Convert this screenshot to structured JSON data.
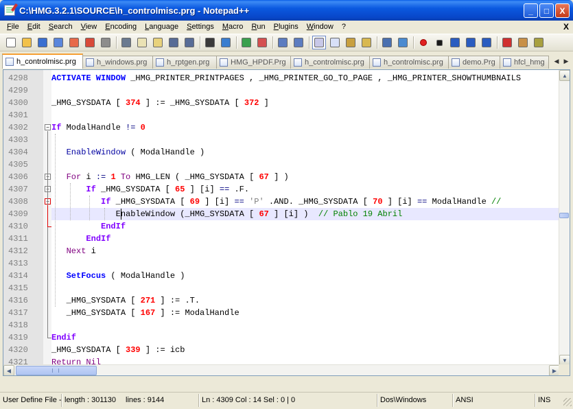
{
  "window": {
    "title": "C:\\HMG.3.2.1\\SOURCE\\h_controlmisc.prg - Notepad++",
    "minimize": "_",
    "maximize": "□",
    "close": "X"
  },
  "menu": {
    "items": [
      "File",
      "Edit",
      "Search",
      "View",
      "Encoding",
      "Language",
      "Settings",
      "Macro",
      "Run",
      "Plugins",
      "Window",
      "?"
    ],
    "close_doc": "X"
  },
  "toolbar": {
    "icons": [
      "new-file-icon",
      "open-file-icon",
      "save-icon",
      "save-all-icon",
      "close-icon",
      "close-all-icon",
      "print-icon",
      "cut-icon",
      "copy-icon",
      "paste-icon",
      "undo-icon",
      "redo-icon",
      "find-icon",
      "replace-icon",
      "zoom-in-icon",
      "zoom-out-icon",
      "sync-vertical-icon",
      "sync-horizontal-icon",
      "word-wrap-icon",
      "show-all-chars-icon",
      "indent-guide-icon",
      "user-define-lang-icon",
      "doc-map-icon",
      "function-list-icon",
      "record-macro-icon",
      "stop-macro-icon",
      "play-macro-icon",
      "run-macro-multiple-icon",
      "save-macro-icon",
      "spellcheck-icon",
      "clipboard-history-icon",
      "plugin-icon"
    ]
  },
  "tabs": [
    {
      "label": "h_controlmisc.prg",
      "active": true
    },
    {
      "label": "h_windows.prg",
      "active": false
    },
    {
      "label": "h_rptgen.prg",
      "active": false
    },
    {
      "label": "HMG_HPDF.Prg",
      "active": false
    },
    {
      "label": "h_controlmisc.prg",
      "active": false
    },
    {
      "label": "h_controlmisc.prg",
      "active": false
    },
    {
      "label": "demo.Prg",
      "active": false
    },
    {
      "label": "hfcl_hmg",
      "active": false
    }
  ],
  "editor": {
    "lines": [
      {
        "n": "4298",
        "segs": [
          [
            "kw",
            "ACTIVATE WINDOW"
          ],
          [
            "txt",
            " _HMG_PRINTER_PRINTPAGES , _HMG_PRINTER_GO_TO_PAGE , _HMG_PRINTER_SHOWTHUMBNAILS"
          ]
        ]
      },
      {
        "n": "4299",
        "segs": []
      },
      {
        "n": "4300",
        "segs": [
          [
            "txt",
            "_HMG_SYSDATA [ "
          ],
          [
            "num",
            "374"
          ],
          [
            "txt",
            " ] := _HMG_SYSDATA [ "
          ],
          [
            "num",
            "372"
          ],
          [
            "txt",
            " ]"
          ]
        ]
      },
      {
        "n": "4301",
        "segs": []
      },
      {
        "n": "4302",
        "segs": [
          [
            "kw2",
            "If"
          ],
          [
            "txt",
            " ModalHandle "
          ],
          [
            "op",
            "!="
          ],
          [
            "txt",
            " "
          ],
          [
            "num",
            "0"
          ]
        ]
      },
      {
        "n": "4303",
        "segs": []
      },
      {
        "n": "4304",
        "segs": [
          [
            "txt",
            "   "
          ],
          [
            "fn",
            "EnableWindow"
          ],
          [
            "txt",
            " ( ModalHandle )"
          ]
        ]
      },
      {
        "n": "4305",
        "segs": []
      },
      {
        "n": "4306",
        "segs": [
          [
            "txt",
            "   "
          ],
          [
            "kw3",
            "For"
          ],
          [
            "txt",
            " i "
          ],
          [
            "op",
            ":="
          ],
          [
            "txt",
            " "
          ],
          [
            "num",
            "1"
          ],
          [
            "txt",
            " "
          ],
          [
            "kw3",
            "To"
          ],
          [
            "txt",
            " HMG_LEN ( _HMG_SYSDATA [ "
          ],
          [
            "num",
            "67"
          ],
          [
            "txt",
            " ] )"
          ]
        ]
      },
      {
        "n": "4307",
        "segs": [
          [
            "txt",
            "       "
          ],
          [
            "kw2",
            "If"
          ],
          [
            "txt",
            " _HMG_SYSDATA [ "
          ],
          [
            "num",
            "65"
          ],
          [
            "txt",
            " ] [i] "
          ],
          [
            "op",
            "=="
          ],
          [
            "txt",
            " .F."
          ]
        ]
      },
      {
        "n": "4308",
        "segs": [
          [
            "txt",
            "          "
          ],
          [
            "kw2",
            "If"
          ],
          [
            "txt",
            " _HMG_SYSDATA [ "
          ],
          [
            "num",
            "69"
          ],
          [
            "txt",
            " ] [i] "
          ],
          [
            "op",
            "=="
          ],
          [
            "txt",
            " "
          ],
          [
            "str",
            "'P'"
          ],
          [
            "txt",
            " .AND. _HMG_SYSDATA [ "
          ],
          [
            "num",
            "70"
          ],
          [
            "txt",
            " ] [i] "
          ],
          [
            "op",
            "=="
          ],
          [
            "txt",
            " ModalHandle "
          ],
          [
            "cmt",
            "// "
          ]
        ]
      },
      {
        "n": "4309",
        "segs": [
          [
            "txt",
            "             EnableWindow (_HMG_SYSDATA [ "
          ],
          [
            "num",
            "67"
          ],
          [
            "txt",
            " ] [i] )  "
          ],
          [
            "cmt",
            "// Pablo 19 Abril"
          ]
        ],
        "current": true
      },
      {
        "n": "4310",
        "segs": [
          [
            "txt",
            "          "
          ],
          [
            "kw2",
            "EndIf"
          ]
        ]
      },
      {
        "n": "4311",
        "segs": [
          [
            "txt",
            "       "
          ],
          [
            "kw2",
            "EndIf"
          ]
        ]
      },
      {
        "n": "4312",
        "segs": [
          [
            "txt",
            "   "
          ],
          [
            "kw3",
            "Next"
          ],
          [
            "txt",
            " i"
          ]
        ]
      },
      {
        "n": "4313",
        "segs": []
      },
      {
        "n": "4314",
        "segs": [
          [
            "txt",
            "   "
          ],
          [
            "kw",
            "SetFocus"
          ],
          [
            "txt",
            " ( ModalHandle )"
          ]
        ]
      },
      {
        "n": "4315",
        "segs": []
      },
      {
        "n": "4316",
        "segs": [
          [
            "txt",
            "   _HMG_SYSDATA [ "
          ],
          [
            "num",
            "271"
          ],
          [
            "txt",
            " ] := .T."
          ]
        ]
      },
      {
        "n": "4317",
        "segs": [
          [
            "txt",
            "   _HMG_SYSDATA [ "
          ],
          [
            "num",
            "167"
          ],
          [
            "txt",
            " ] := ModalHandle"
          ]
        ]
      },
      {
        "n": "4318",
        "segs": []
      },
      {
        "n": "4319",
        "segs": [
          [
            "kw2",
            "Endif"
          ]
        ]
      },
      {
        "n": "4320",
        "segs": [
          [
            "txt",
            "_HMG_SYSDATA [ "
          ],
          [
            "num",
            "339"
          ],
          [
            "txt",
            " ] := icb"
          ]
        ]
      },
      {
        "n": "4321",
        "segs": [
          [
            "kw3",
            "Return Nil"
          ]
        ]
      },
      {
        "n": "4322",
        "segs": []
      }
    ]
  },
  "status": {
    "filetype": "User Define File - ",
    "length": "length : 301130",
    "lines": "lines : 9144",
    "pos": "Ln : 4309    Col : 14    Sel : 0 | 0",
    "eol": "Dos\\Windows",
    "encoding": "ANSI",
    "mode": "INS"
  },
  "colors": {
    "accent_tab": "#f6a034",
    "fold_marker": "#e00000",
    "current_line": "#e8e8ff"
  }
}
